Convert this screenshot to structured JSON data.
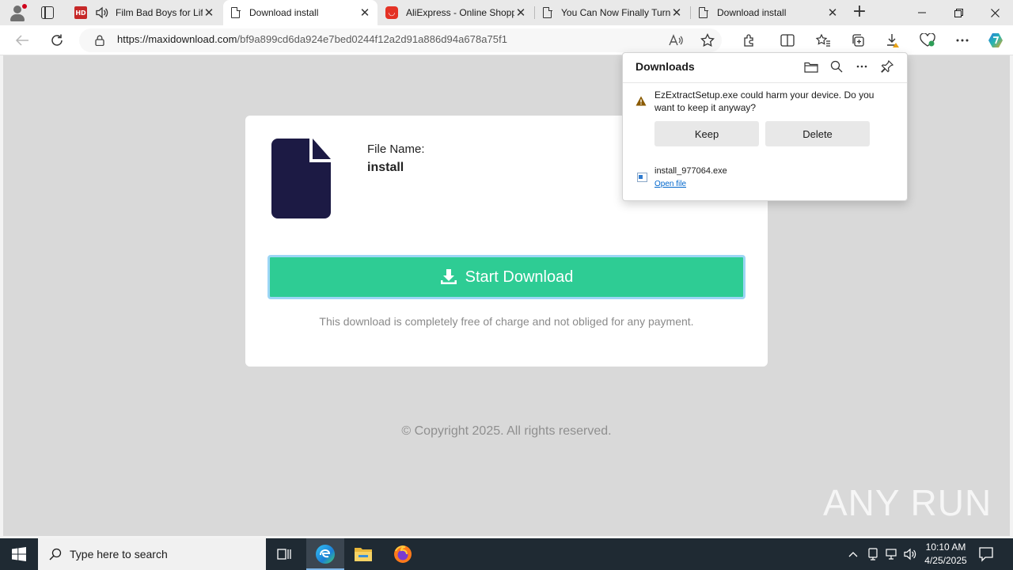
{
  "browser": {
    "tabs": [
      {
        "title": "Film Bad Boys for Life",
        "favicon": "hd-icon",
        "favicon_text": "HD",
        "audio": true
      },
      {
        "title": "Download install",
        "favicon": "page-icon",
        "active": true
      },
      {
        "title": "AliExpress - Online Shopping",
        "favicon": "aliexpress-icon"
      },
      {
        "title": "You Can Now Finally Turn",
        "favicon": "page-icon"
      },
      {
        "title": "Download install",
        "favicon": "page-icon"
      }
    ],
    "url_domain": "https://maxidownload.com",
    "url_path": "/bf9a899cd6da924e7bed0244f12a2d91a886d94a678a75f1"
  },
  "downloads": {
    "title": "Downloads",
    "warning": "EzExtractSetup.exe could harm your device. Do you want to keep it anyway?",
    "keep_label": "Keep",
    "delete_label": "Delete",
    "file_name": "install_977064.exe",
    "open_file_label": "Open file"
  },
  "page": {
    "file_name_label": "File Name:",
    "file_name_value": "install",
    "start_button": "Start Download",
    "free_note": "This download is completely free of charge and not obliged for any payment.",
    "copyright": "© Copyright 2025. All rights reserved.",
    "watermark": "ANY RUN"
  },
  "taskbar": {
    "search_placeholder": "Type here to search",
    "time": "10:10 AM",
    "date": "4/25/2025"
  },
  "colors": {
    "start_button": "#2ecc94",
    "file_icon": "#1c1a44",
    "page_bg": "#d9d9d9",
    "taskbar": "#1f2a33"
  }
}
